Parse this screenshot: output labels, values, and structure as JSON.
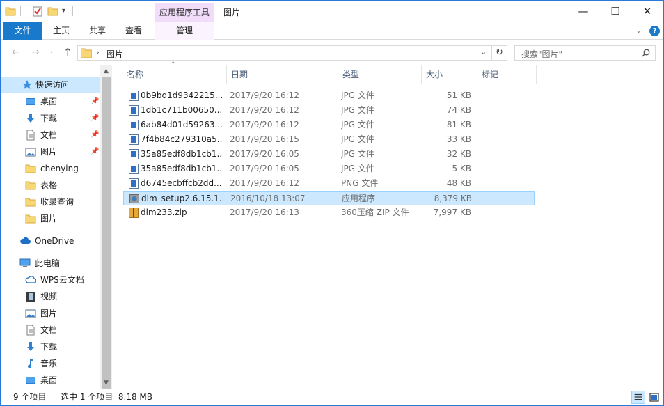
{
  "window": {
    "title": "图片",
    "context_tab": "应用程序工具",
    "controls": {
      "minimize": "—",
      "maximize": "☐",
      "close": "✕"
    }
  },
  "ribbon": {
    "tabs": [
      "文件",
      "主页",
      "共享",
      "查看"
    ],
    "manage_tab": "管理"
  },
  "address": {
    "path": "图片",
    "search_placeholder": "搜索\"图片\""
  },
  "nav": {
    "items": [
      {
        "label": "快速访问",
        "icon": "star-icon",
        "selected": true,
        "pinned": false
      },
      {
        "label": "桌面",
        "icon": "desktop-icon",
        "pinned": true
      },
      {
        "label": "下载",
        "icon": "download-icon",
        "pinned": true
      },
      {
        "label": "文档",
        "icon": "document-icon",
        "pinned": true
      },
      {
        "label": "图片",
        "icon": "pictures-icon",
        "pinned": true
      },
      {
        "label": "chenying",
        "icon": "folder-icon",
        "pinned": false
      },
      {
        "label": "表格",
        "icon": "folder-icon",
        "pinned": false
      },
      {
        "label": "收录查询",
        "icon": "folder-icon",
        "pinned": false
      },
      {
        "label": "图片",
        "icon": "folder-icon",
        "pinned": false
      },
      {
        "label": "OneDrive",
        "icon": "cloud-icon",
        "pinned": false
      },
      {
        "label": "此电脑",
        "icon": "computer-icon",
        "pinned": false
      },
      {
        "label": "WPS云文档",
        "icon": "wps-cloud-icon",
        "pinned": false
      },
      {
        "label": "视频",
        "icon": "video-icon",
        "pinned": false
      },
      {
        "label": "图片",
        "icon": "pictures-icon",
        "pinned": false
      },
      {
        "label": "文档",
        "icon": "document-icon",
        "pinned": false
      },
      {
        "label": "下载",
        "icon": "download-icon",
        "pinned": false
      },
      {
        "label": "音乐",
        "icon": "music-icon",
        "pinned": false
      },
      {
        "label": "桌面",
        "icon": "desktop-icon",
        "pinned": false
      }
    ]
  },
  "columns": {
    "name": "名称",
    "date": "日期",
    "type": "类型",
    "size": "大小",
    "tags": "标记"
  },
  "files": [
    {
      "name": "0b9bd1d9342215...",
      "date": "2017/9/20 16:12",
      "type": "JPG 文件",
      "size": "51 KB",
      "icon": "image-file-icon"
    },
    {
      "name": "1db1c711b00650...",
      "date": "2017/9/20 16:12",
      "type": "JPG 文件",
      "size": "74 KB",
      "icon": "image-file-icon"
    },
    {
      "name": "6ab84d01d59263...",
      "date": "2017/9/20 16:12",
      "type": "JPG 文件",
      "size": "81 KB",
      "icon": "image-file-icon"
    },
    {
      "name": "7f4b84c279310a5...",
      "date": "2017/9/20 16:15",
      "type": "JPG 文件",
      "size": "33 KB",
      "icon": "image-file-icon"
    },
    {
      "name": "35a85edf8db1cb1...",
      "date": "2017/9/20 16:05",
      "type": "JPG 文件",
      "size": "32 KB",
      "icon": "image-file-icon"
    },
    {
      "name": "35a85edf8db1cb1...",
      "date": "2017/9/20 16:05",
      "type": "JPG 文件",
      "size": "5 KB",
      "icon": "image-file-icon"
    },
    {
      "name": "d6745ecbffcb2dd...",
      "date": "2017/9/20 16:12",
      "type": "PNG 文件",
      "size": "48 KB",
      "icon": "image-file-icon"
    },
    {
      "name": "dlm_setup2.6.15.1...",
      "date": "2016/10/18 13:07",
      "type": "应用程序",
      "size": "8,379 KB",
      "icon": "installer-icon",
      "selected": true
    },
    {
      "name": "dlm233.zip",
      "date": "2017/9/20 16:13",
      "type": "360压缩 ZIP 文件",
      "size": "7,997 KB",
      "icon": "zip-archive-icon"
    }
  ],
  "status": {
    "count": "9 个项目",
    "selection": "选中 1 个项目  8.18 MB"
  },
  "colors": {
    "accent": "#1979ca",
    "selection": "#cce8ff",
    "context_tab": "#f1dcf9"
  }
}
